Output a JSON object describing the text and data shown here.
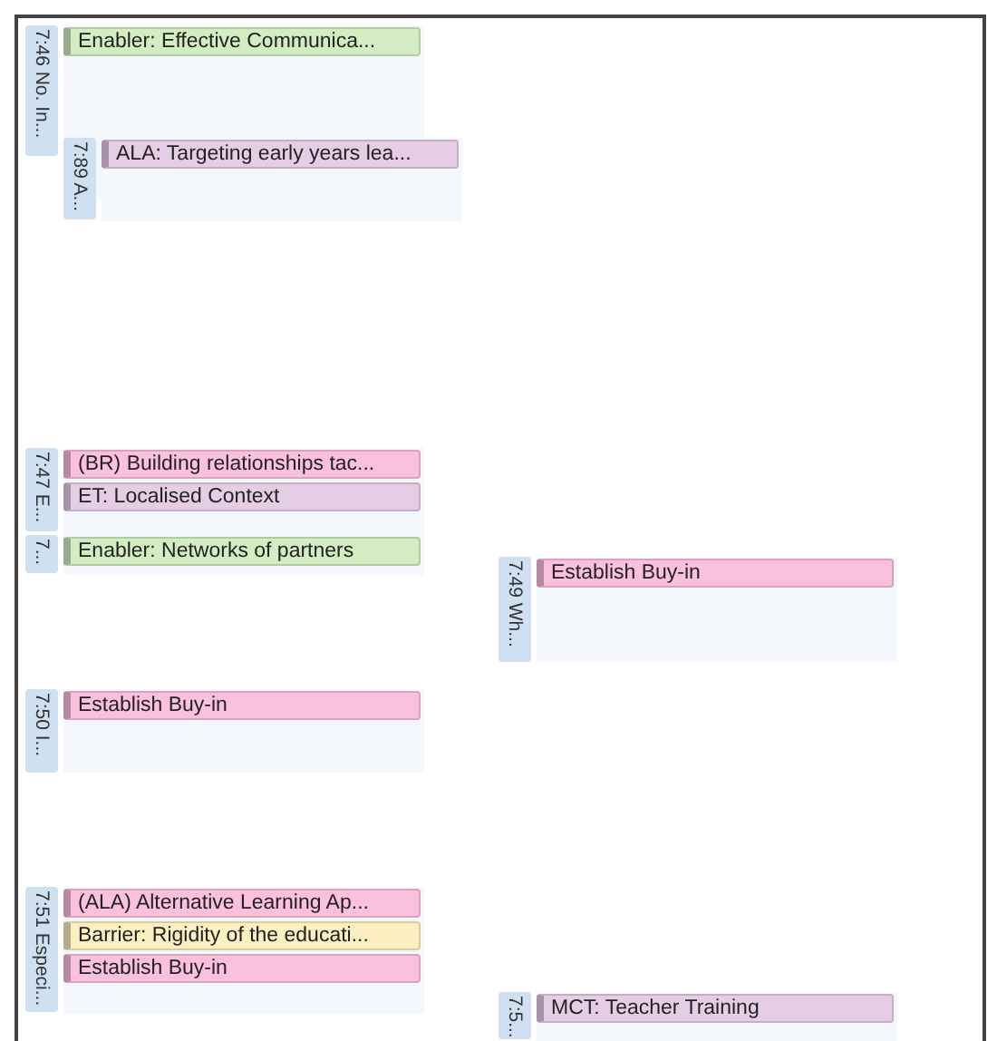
{
  "segments": [
    {
      "label": "7:46 No. In...",
      "codes": [
        {
          "text": "Enabler: Effective Communica...",
          "color": "#d4ecc2"
        }
      ]
    },
    {
      "label": "7:89 A...",
      "codes": [
        {
          "text": "ALA: Targeting early years lea...",
          "color": "#e6cde6"
        }
      ]
    },
    {
      "label": "7:47 E...",
      "codes": [
        {
          "text": "(BR) Building relationships tac...",
          "color": "#fbc0dd"
        },
        {
          "text": "ET: Localised Context",
          "color": "#e6cde6"
        }
      ]
    },
    {
      "label": "7...",
      "codes": [
        {
          "text": "Enabler: Networks of partners",
          "color": "#d4ecc2"
        }
      ]
    },
    {
      "label": "7:49 Wh...",
      "codes": [
        {
          "text": "Establish Buy-in",
          "color": "#fbc0dd"
        }
      ]
    },
    {
      "label": "7:50 I...",
      "codes": [
        {
          "text": "Establish Buy-in",
          "color": "#fbc0dd"
        }
      ]
    },
    {
      "label": "7:51 Especi...",
      "codes": [
        {
          "text": "(ALA) Alternative Learning Ap...",
          "color": "#fbc0dd"
        },
        {
          "text": "Barrier: Rigidity of the educati...",
          "color": "#fcefc2"
        },
        {
          "text": "Establish Buy-in",
          "color": "#fbc0dd"
        }
      ]
    },
    {
      "label": "7:5...",
      "codes": [
        {
          "text": "MCT: Teacher Training",
          "color": "#e6cde6"
        }
      ]
    }
  ]
}
